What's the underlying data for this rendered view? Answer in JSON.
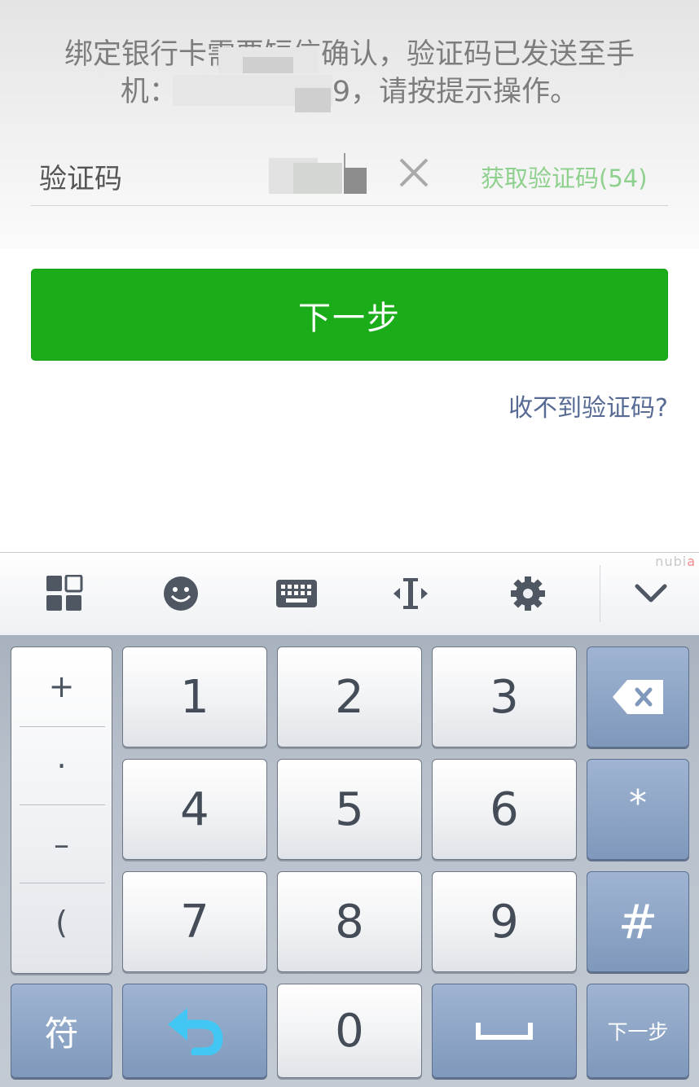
{
  "notice": {
    "line1": "绑定银行卡需要短信确认，验证码已发送至手",
    "line2_prefix": "机：",
    "line2_suffix": "9，请按提示操作。"
  },
  "code_field": {
    "label": "验证码",
    "clear_icon": "close-icon",
    "get_code_label": "获取验证码(54)"
  },
  "next_button": "下一步",
  "no_code_link": "收不到验证码?",
  "keyboard": {
    "brand": "nubia",
    "toolbar": [
      "apps-grid-icon",
      "emoji-icon",
      "keyboard-icon",
      "cursor-move-icon",
      "gear-icon",
      "chevron-down-icon"
    ],
    "symbols": [
      "+",
      "·",
      "–",
      "("
    ],
    "digits": [
      "1",
      "2",
      "3",
      "4",
      "5",
      "6",
      "7",
      "8",
      "9",
      "0"
    ],
    "star": "*",
    "hash": "#",
    "fu_label": "符",
    "enter_label": "下一步"
  },
  "colors": {
    "primary_green": "#1aad19",
    "link_blue": "#576b95",
    "countdown_green": "#8ed08e"
  }
}
